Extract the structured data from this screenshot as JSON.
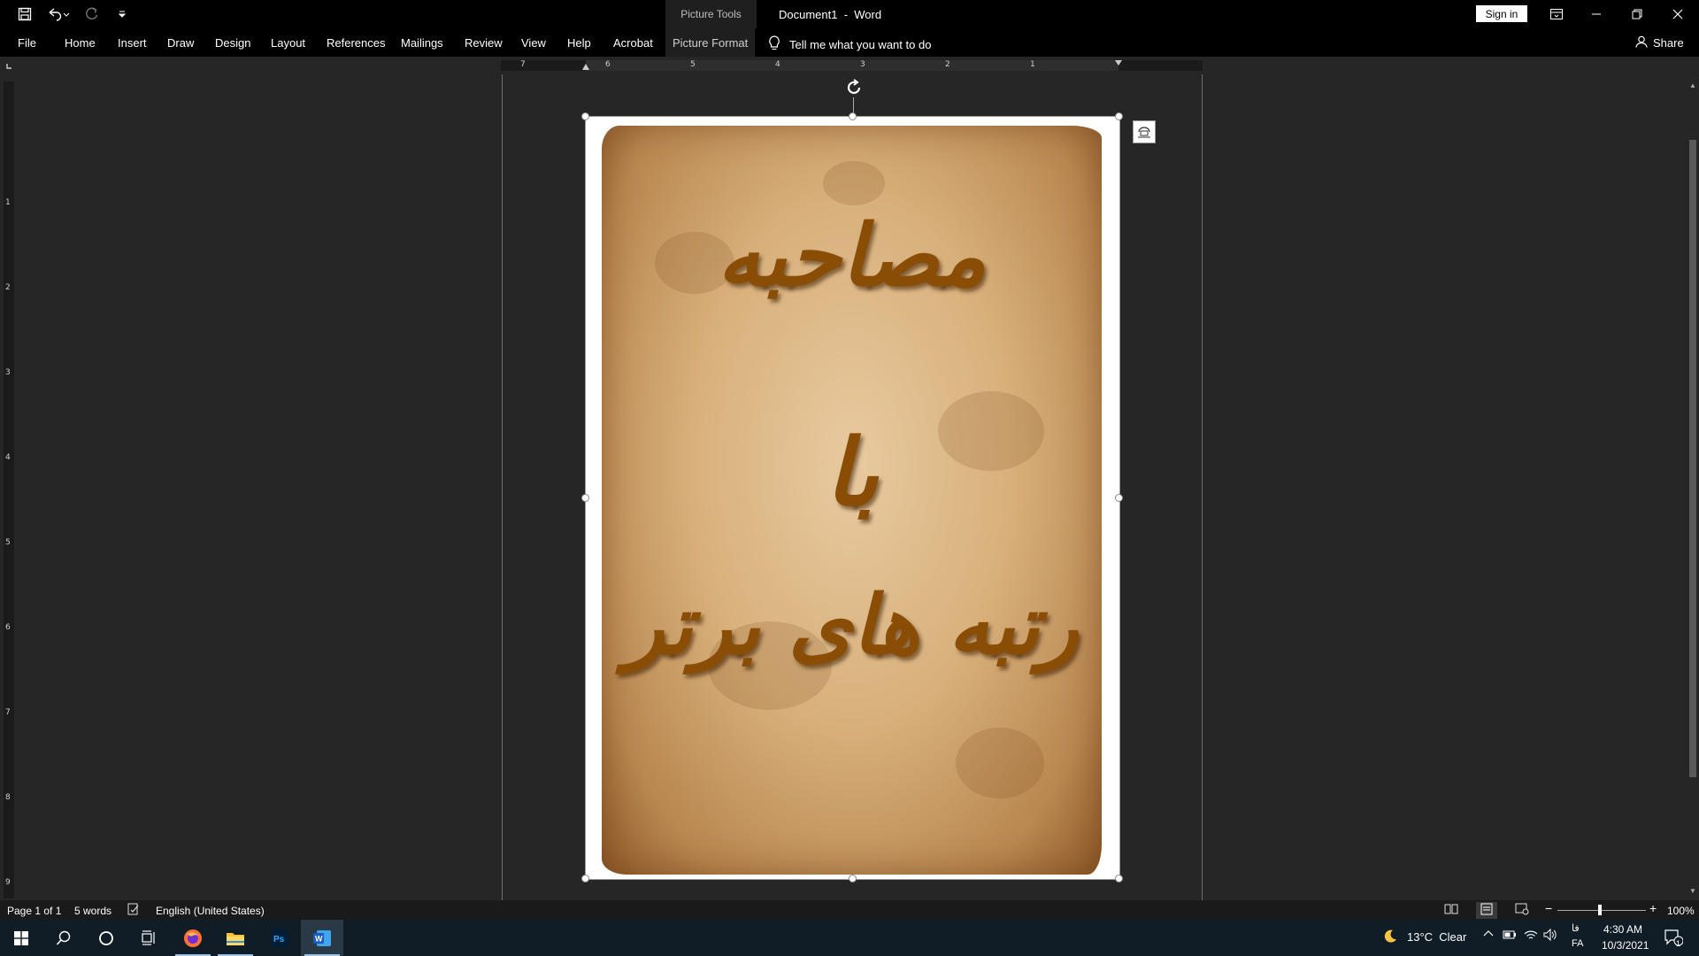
{
  "titlebar": {
    "contextual_group": "Picture Tools",
    "document_title": "Document1  -  Word",
    "sign_in": "Sign in"
  },
  "ribbon": {
    "tabs": [
      "File",
      "Home",
      "Insert",
      "Draw",
      "Design",
      "Layout",
      "References",
      "Mailings",
      "Review",
      "View",
      "Help",
      "Acrobat"
    ],
    "contextual_tab": "Picture Format",
    "tell_me": "Tell me what you want to do",
    "share": "Share"
  },
  "ruler": {
    "horizontal_numbers": [
      "7",
      "6",
      "5",
      "4",
      "3",
      "2",
      "1"
    ],
    "vertical_numbers": [
      "1",
      "2",
      "3",
      "4",
      "5",
      "6",
      "7",
      "8",
      "9"
    ]
  },
  "document": {
    "image_text_lines": [
      "مصاحبه",
      "با",
      "رتبه های برتر"
    ]
  },
  "statusbar": {
    "page": "Page 1 of 1",
    "words": "5 words",
    "language": "English (United States)",
    "zoom": "100%"
  },
  "taskbar": {
    "weather": "13°C  Clear",
    "time": "4:30 AM",
    "date": "10/3/2021",
    "input_lang": "FA",
    "input_lang_native": "فا",
    "notification_count": "1"
  },
  "colors": {
    "calligraphy": "#8a4d05",
    "taskbar": "#101d27",
    "app_background": "#262626"
  }
}
